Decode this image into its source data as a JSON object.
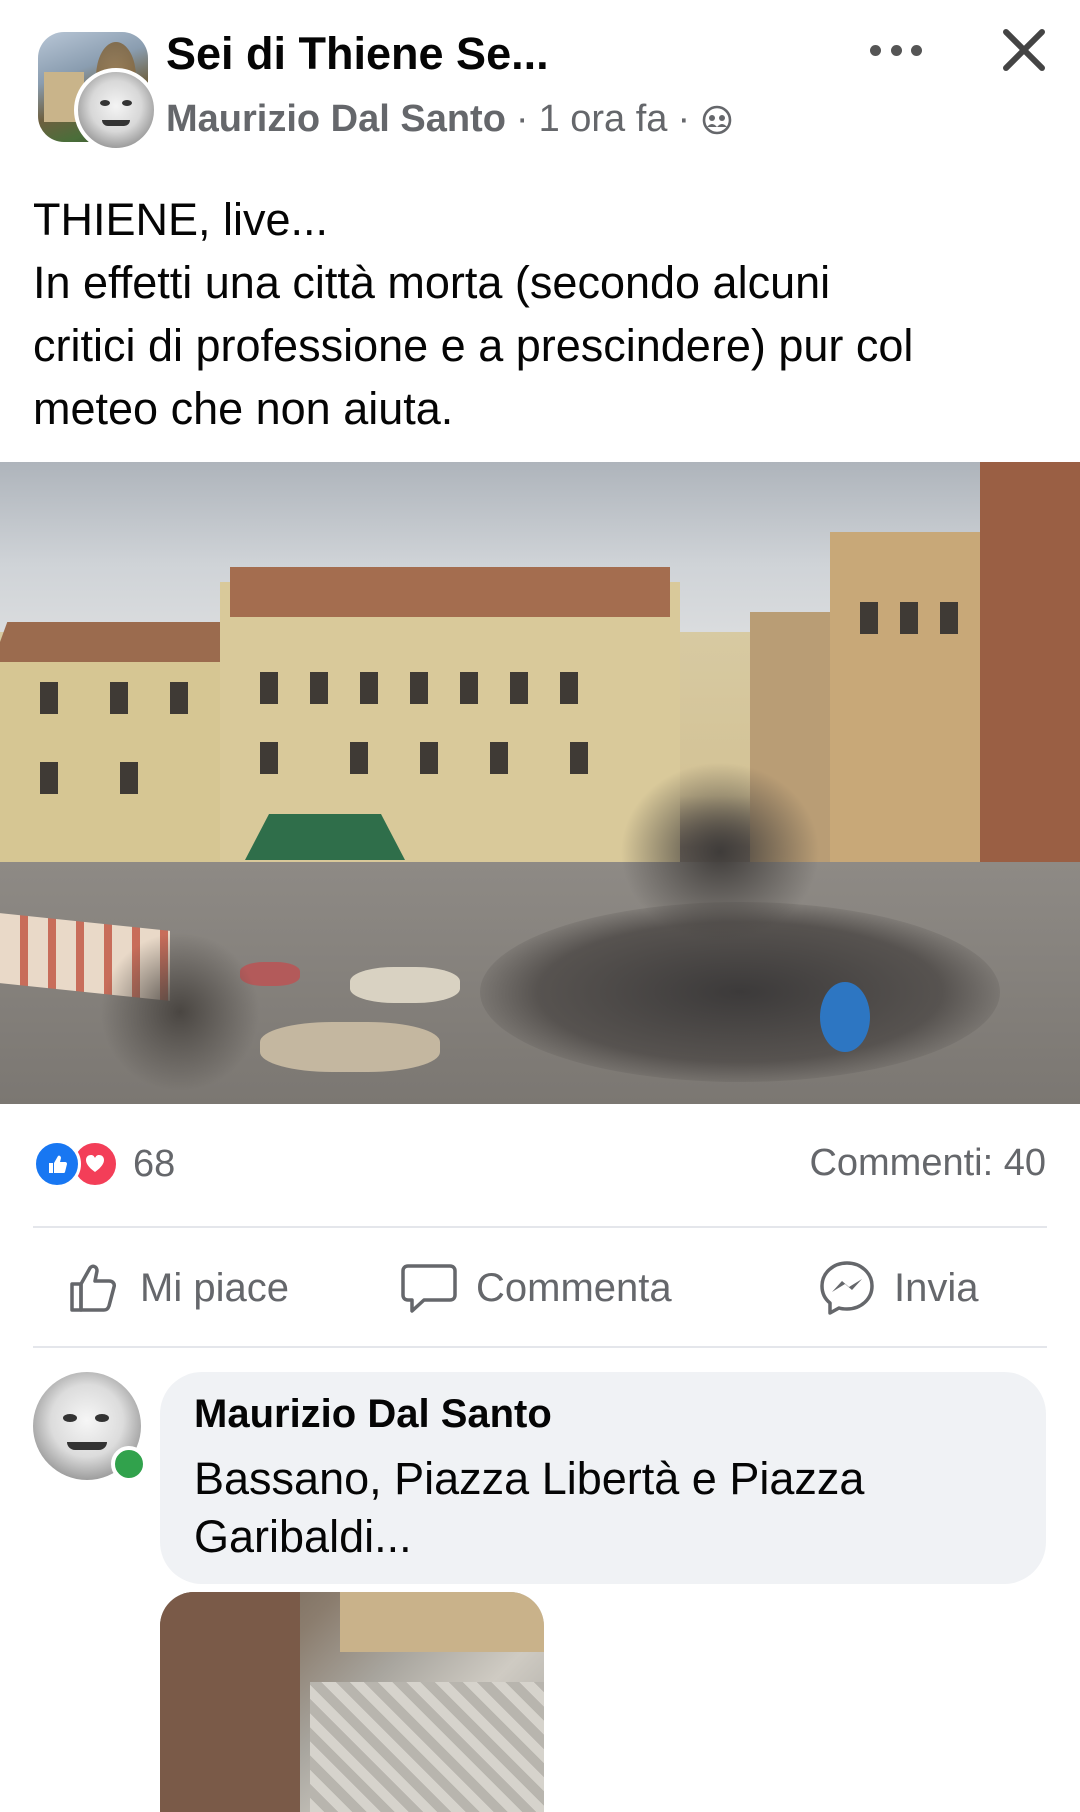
{
  "post": {
    "group_name": "Sei di Thiene Se...",
    "author": "Maurizio Dal Santo",
    "separator": "·",
    "time": "1 ora fa",
    "privacy_icon": "group-members-icon",
    "text_lines": [
      "THIENE, live...",
      "In effetti una città morta (secondo alcuni",
      "critici di professione e a prescindere) pur col",
      "meteo che non aiuta."
    ]
  },
  "engagement": {
    "reaction_icons": [
      "like-reaction-icon",
      "love-reaction-icon"
    ],
    "reactions_count": "68",
    "comments_label": "Commenti: 40"
  },
  "actions": {
    "like": "Mi piace",
    "comment": "Commenta",
    "send": "Invia"
  },
  "comment": {
    "author": "Maurizio Dal Santo",
    "text_lines": [
      "Bassano, Piazza Libertà e Piazza",
      "Garibaldi..."
    ],
    "online": true
  },
  "colors": {
    "primary_text": "#050505",
    "secondary_text": "#65676b",
    "like_blue": "#1877f2",
    "love_red": "#f33e58",
    "online_green": "#31a24c",
    "bubble_bg": "#f0f2f5",
    "divider": "#e4e6eb"
  }
}
